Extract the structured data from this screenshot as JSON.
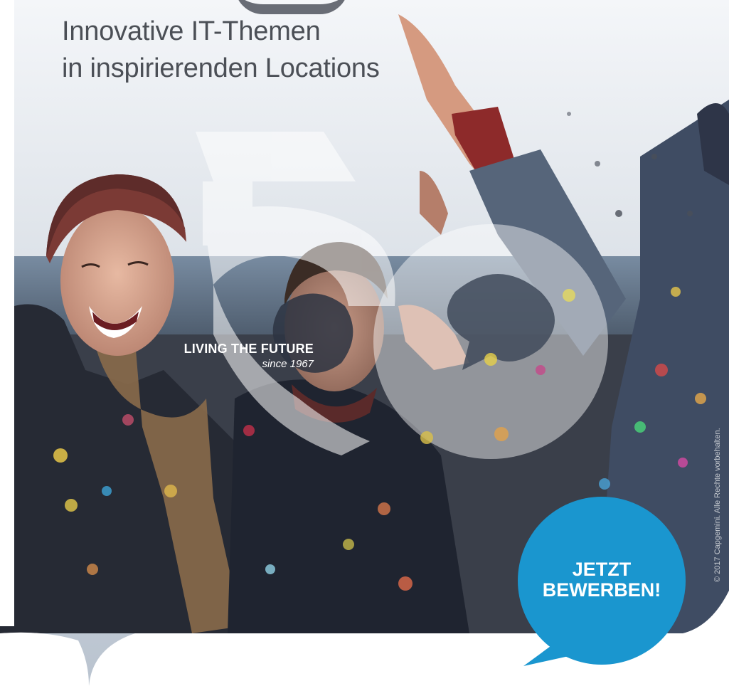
{
  "headline": {
    "line1": "Innovative IT-Themen",
    "line2": "in inspirierenden Locations"
  },
  "tagline": {
    "main": "LIVING THE FUTURE",
    "sub": "since 1967"
  },
  "cta": {
    "line1": "JETZT",
    "line2": "BEWERBEN!"
  },
  "copyright": "© 2017 Capgemini. Alle Rechte vorbehalten.",
  "colors": {
    "cta_blue": "#1a96cf",
    "headline_gray": "#4b4f56",
    "sky": "#cfd6e0",
    "sea": "#5d6f83",
    "jacket_dark": "#2b2f3a",
    "beanie_red": "#7a2f2f"
  }
}
